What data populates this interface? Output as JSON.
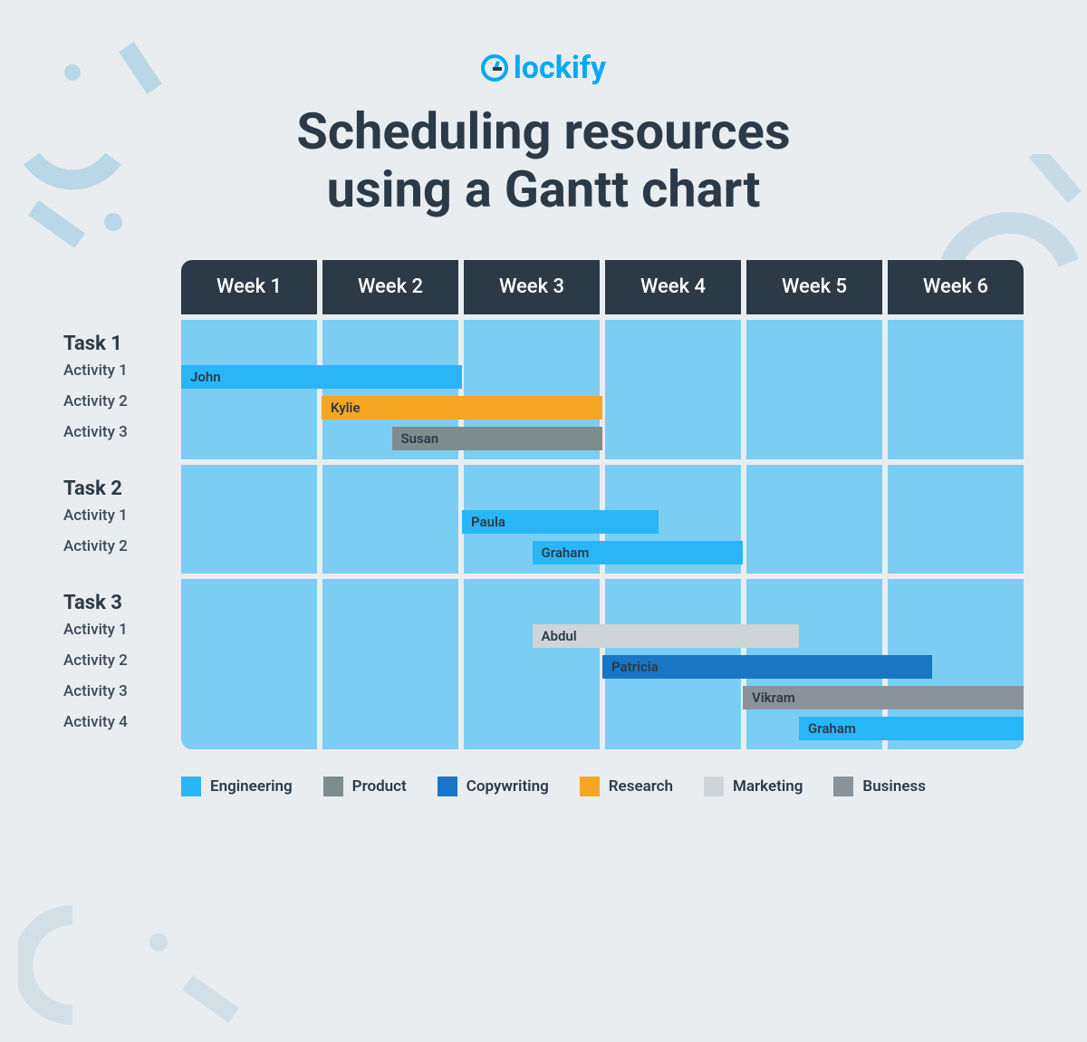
{
  "brand": "lockify",
  "title_line1": "Scheduling resources",
  "title_line2": "using a Gantt chart",
  "chart_data": {
    "type": "gantt",
    "xlabel": "",
    "ylabel": "",
    "x_unit": "weeks",
    "x_range": [
      0,
      6
    ],
    "columns": [
      "Week 1",
      "Week 2",
      "Week 3",
      "Week 4",
      "Week 5",
      "Week 6"
    ],
    "tasks": [
      {
        "name": "Task 1",
        "activities": [
          {
            "name": "Activity 1",
            "assignee": "John",
            "category": "Engineering",
            "start": 0.0,
            "end": 2.0
          },
          {
            "name": "Activity 2",
            "assignee": "Kylie",
            "category": "Research",
            "start": 1.0,
            "end": 3.0
          },
          {
            "name": "Activity 3",
            "assignee": "Susan",
            "category": "Product",
            "start": 1.5,
            "end": 3.0
          }
        ]
      },
      {
        "name": "Task 2",
        "activities": [
          {
            "name": "Activity 1",
            "assignee": "Paula",
            "category": "Engineering",
            "start": 2.0,
            "end": 3.4
          },
          {
            "name": "Activity 2",
            "assignee": "Graham",
            "category": "Engineering",
            "start": 2.5,
            "end": 4.0
          }
        ]
      },
      {
        "name": "Task 3",
        "activities": [
          {
            "name": "Activity 1",
            "assignee": "Abdul",
            "category": "Marketing",
            "start": 2.5,
            "end": 4.4
          },
          {
            "name": "Activity 2",
            "assignee": "Patricia",
            "category": "Copywriting",
            "start": 3.0,
            "end": 5.35
          },
          {
            "name": "Activity 3",
            "assignee": "Vikram",
            "category": "Business",
            "start": 4.0,
            "end": 6.0
          },
          {
            "name": "Activity 4",
            "assignee": "Graham",
            "category": "Engineering",
            "start": 4.4,
            "end": 6.0
          }
        ]
      }
    ],
    "categories": [
      {
        "name": "Engineering",
        "color": "#29b6f6"
      },
      {
        "name": "Product",
        "color": "#7f8c8d"
      },
      {
        "name": "Copywriting",
        "color": "#1976c5"
      },
      {
        "name": "Research",
        "color": "#f5a623"
      },
      {
        "name": "Marketing",
        "color": "#cfd4d8"
      },
      {
        "name": "Business",
        "color": "#8a9399"
      }
    ]
  },
  "layout": {
    "task_header_h": 46,
    "activity_row_h": 34,
    "task_block_pad_bottom": 6,
    "task_gap": 10
  }
}
